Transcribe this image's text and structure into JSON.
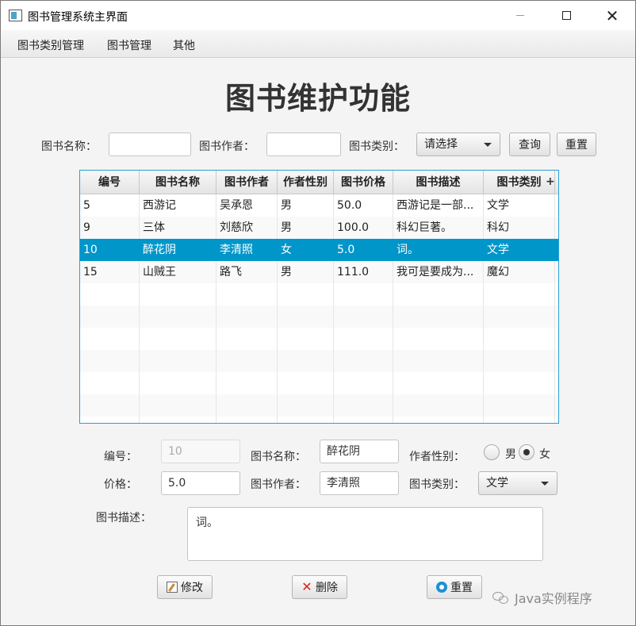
{
  "window": {
    "title": "图书管理系统主界面"
  },
  "menu": {
    "items": [
      "图书类别管理",
      "图书管理",
      "其他"
    ]
  },
  "page": {
    "heading": "图书维护功能"
  },
  "search": {
    "name_label": "图书名称：",
    "name_value": "",
    "author_label": "图书作者：",
    "author_value": "",
    "type_label": "图书类别：",
    "type_selected": "请选择",
    "query_button": "查询",
    "reset_button": "重置"
  },
  "table": {
    "columns": [
      "编号",
      "图书名称",
      "图书作者",
      "作者性别",
      "图书价格",
      "图书描述",
      "图书类别"
    ],
    "rows": [
      [
        "5",
        "西游记",
        "吴承恩",
        "男",
        "50.0",
        "西游记是一部...",
        "文学"
      ],
      [
        "9",
        "三体",
        "刘慈欣",
        "男",
        "100.0",
        "科幻巨著。",
        "科幻"
      ],
      [
        "10",
        "醉花阴",
        "李清照",
        "女",
        "5.0",
        "词。",
        "文学"
      ],
      [
        "15",
        "山贼王",
        "路飞",
        "男",
        "111.0",
        "我可是要成为...",
        "魔幻"
      ]
    ],
    "selected_row": 2,
    "corner_symbol": "+"
  },
  "form": {
    "id_label": "编号：",
    "id_value": "10",
    "name_label": "图书名称：",
    "name_value": "醉花阴",
    "sex_label": "作者性别：",
    "sex_options": [
      "男",
      "女"
    ],
    "sex_selected": "女",
    "price_label": "价格：",
    "price_value": "5.0",
    "author_label": "图书作者：",
    "author_value": "李清照",
    "type_label": "图书类别：",
    "type_selected": "文学",
    "desc_label": "图书描述：",
    "desc_value": "词。"
  },
  "actions": {
    "modify": "修改",
    "delete": "删除",
    "reset": "重置"
  },
  "watermark": {
    "text": "Java实例程序"
  }
}
